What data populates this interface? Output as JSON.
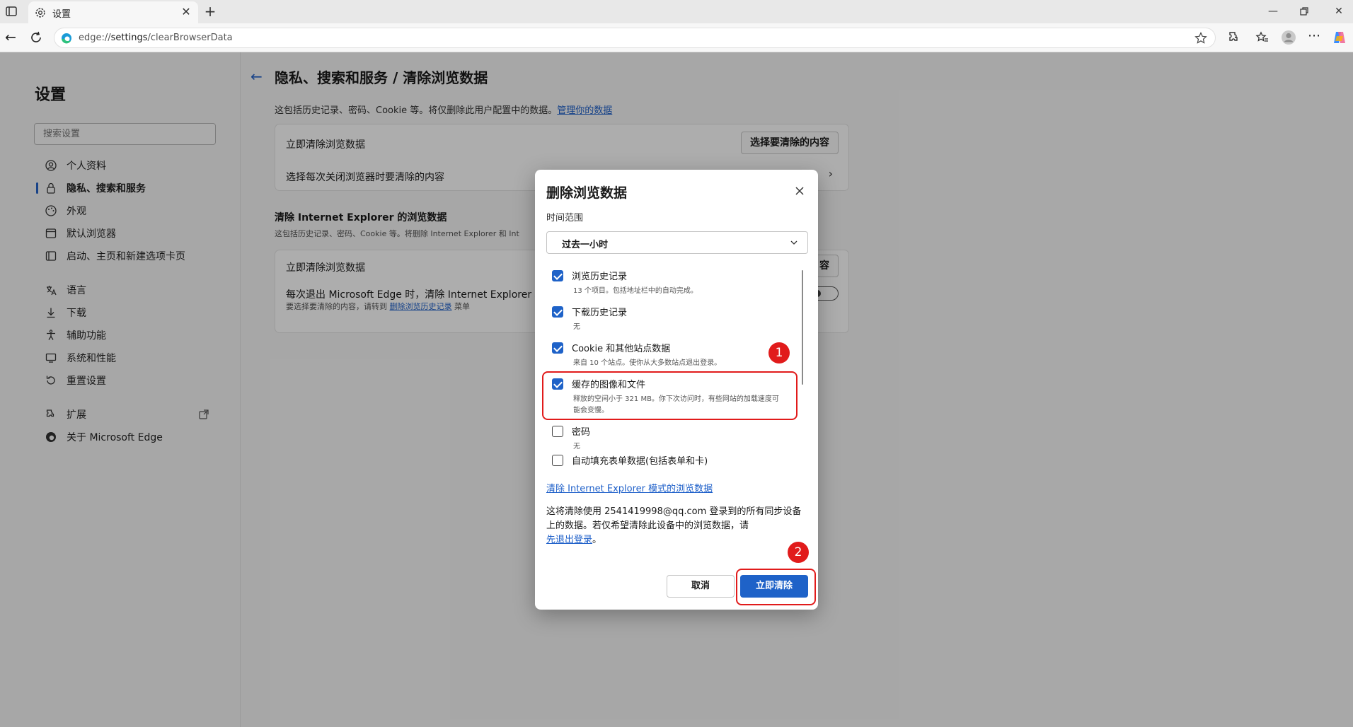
{
  "browser": {
    "tab_title": "设置",
    "url_host": "edge://",
    "url_path_bold": "settings",
    "url_rest": "/clearBrowserData",
    "new_tab_glyph": "+",
    "tab_close_glyph": "✕"
  },
  "sidebar": {
    "title": "设置",
    "search_placeholder": "搜索设置",
    "items": [
      {
        "label": "个人资料",
        "icon": "profile-icon"
      },
      {
        "label": "隐私、搜索和服务",
        "icon": "lock-icon",
        "active": true
      },
      {
        "label": "外观",
        "icon": "appearance-icon"
      },
      {
        "label": "默认浏览器",
        "icon": "browser-icon"
      },
      {
        "label": "启动、主页和新建选项卡页",
        "icon": "home-icon"
      },
      {
        "label": "语言",
        "icon": "language-icon"
      },
      {
        "label": "下载",
        "icon": "download-icon"
      },
      {
        "label": "辅助功能",
        "icon": "accessibility-icon"
      },
      {
        "label": "系统和性能",
        "icon": "system-icon"
      },
      {
        "label": "重置设置",
        "icon": "reset-icon"
      },
      {
        "label": "扩展",
        "icon": "extensions-icon"
      },
      {
        "label": "关于 Microsoft Edge",
        "icon": "edge-logo-icon"
      }
    ]
  },
  "main": {
    "title": "隐私、搜索和服务 / 清除浏览数据",
    "subtitle": "这包括历史记录、密码、Cookie 等。将仅删除此用户配置中的数据。",
    "manage_link": "管理你的数据",
    "card1": {
      "row1": "立即清除浏览数据",
      "row1_button": "选择要清除的内容",
      "row2": "选择每次关闭浏览器时要清除的内容"
    },
    "ie_section": {
      "heading": "清除 Internet Explorer 的浏览数据",
      "sub": "这包括历史记录、密码、Cookie 等。将删除 Internet Explorer 和 Int",
      "row1": "立即清除浏览数据",
      "row1_button_partial": "容",
      "row2": "每次退出 Microsoft Edge 时，清除 Internet Explorer 和 Int",
      "row2_note_prefix": "要选择要清除的内容，请转到",
      "row2_note_link": "删除浏览历史记录",
      "row2_note_suffix": "菜单"
    }
  },
  "dialog": {
    "title": "删除浏览数据",
    "time_range_label": "时间范围",
    "time_range_value": "过去一小时",
    "options": [
      {
        "label": "浏览历史记录",
        "desc": "13 个项目。包括地址栏中的自动完成。",
        "checked": true
      },
      {
        "label": "下载历史记录",
        "desc": "无",
        "checked": true
      },
      {
        "label": "Cookie 和其他站点数据",
        "desc": "来自 10 个站点。使你从大多数站点退出登录。",
        "checked": true
      },
      {
        "label": "缓存的图像和文件",
        "desc": "释放的空间小于 321 MB。你下次访问时，有些网站的加载速度可能会变慢。",
        "checked": true
      },
      {
        "label": "密码",
        "desc": "无",
        "checked": false
      },
      {
        "label": "自动填充表单数据(包括表单和卡)",
        "desc": "",
        "checked": false
      }
    ],
    "ie_link": "清除 Internet Explorer 模式的浏览数据",
    "sync_note_prefix": "这将清除使用 2541419998@qq.com 登录到的所有同步设备上的数据。若仅希望清除此设备中的浏览数据，请",
    "sync_note_link": "先退出登录",
    "sync_note_suffix": "。",
    "cancel_label": "取消",
    "clear_label": "立即清除"
  },
  "annotations": {
    "marker1": "1",
    "marker2": "2",
    "color": "#e11b1b"
  },
  "colors": {
    "accent": "#1e62c8",
    "link": "#1d5fc9"
  }
}
